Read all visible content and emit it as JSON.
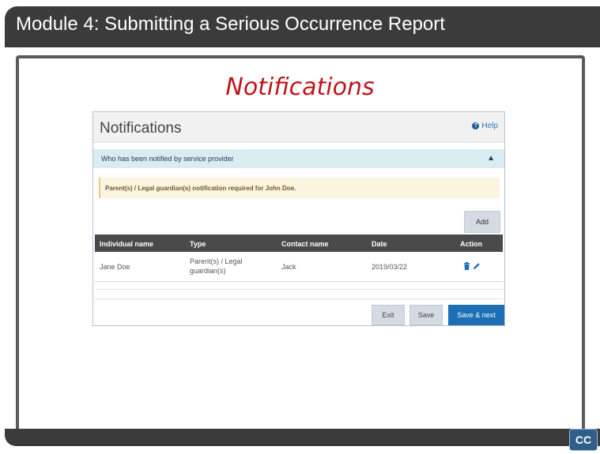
{
  "module_header": {
    "title": "Module 4:  Submitting a Serious Occurrence Report"
  },
  "slide": {
    "heading": "Notifications"
  },
  "screen": {
    "title": "Notifications",
    "help_label": "Help",
    "accordion_label": "Who has been notified by service provider",
    "alert_text": "Parent(s) / Legal guardian(s) notification required for John Doe.",
    "add_label": "Add",
    "table": {
      "headers": [
        "Individual name",
        "Type",
        "Contact name",
        "Date",
        "Action"
      ],
      "rows": [
        {
          "individual_name": "Jane Doe",
          "type": "Parent(s) / Legal guardian(s)",
          "contact_name": "Jack",
          "date": "2019/03/22"
        }
      ]
    },
    "buttons": {
      "exit": "Exit",
      "save": "Save",
      "save_next": "Save & next"
    }
  },
  "player": {
    "cc_label": "CC"
  },
  "colors": {
    "header_bg": "#3b3b3b",
    "heading_red": "#c0141b",
    "primary_blue": "#1c6fb5",
    "alert_bg": "#fcf4e1",
    "accordion_bg": "#d9ecef"
  }
}
